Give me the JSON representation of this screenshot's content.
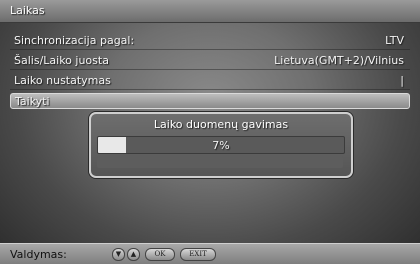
{
  "window": {
    "title": "Laikas"
  },
  "settings": [
    {
      "label": "Sinchronizacija pagal:",
      "value": "LTV"
    },
    {
      "label": "Šalis/Laiko juosta",
      "value": "Lietuva(GMT+2)/Vilnius"
    },
    {
      "label": "Laiko nustatymas",
      "value": "|"
    },
    {
      "label": "Taikyti",
      "value": ""
    }
  ],
  "dialog": {
    "title": "Laiko duomenų gavimas",
    "progress_text": "7%",
    "progress_value": 0.07
  },
  "footer": {
    "label": "Valdymas:",
    "buttons": [
      {
        "icon": "arrow-down-icon",
        "text": "▼"
      },
      {
        "icon": "arrow-up-icon",
        "text": "▲"
      },
      {
        "label": "OK"
      },
      {
        "label": "EXIT"
      }
    ]
  },
  "colors": {
    "selected_row": "#bdbdbd",
    "progress_fill": "#e8e8e8"
  }
}
